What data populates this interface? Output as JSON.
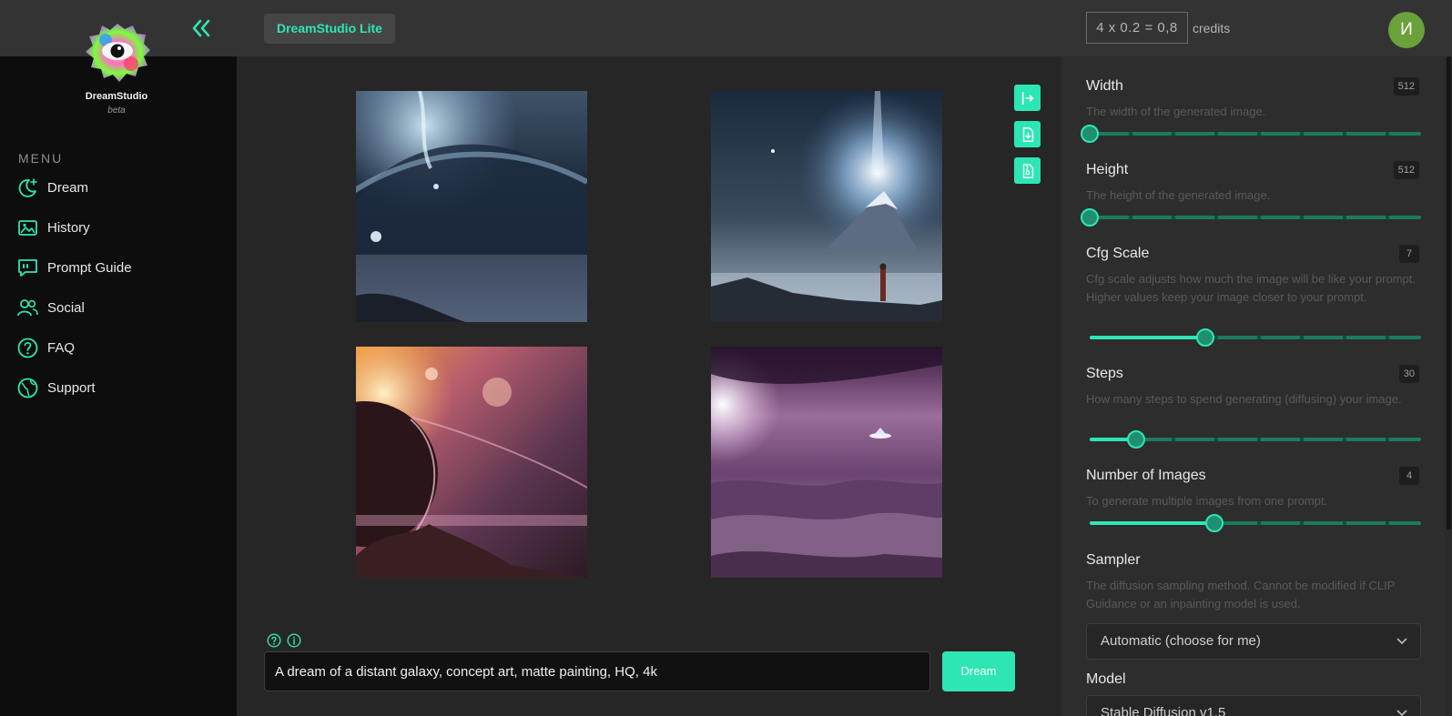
{
  "app": {
    "brand_name": "DreamStudio",
    "brand_tag": "beta",
    "tab_label": "DreamStudio Lite",
    "credits_formula": "4 x 0.2 = 0,8",
    "credits_label": "credits",
    "avatar_initial": "И",
    "accent_color": "#2ee6b4"
  },
  "sidebar": {
    "menu_title": "MENU",
    "items": [
      {
        "label": "Dream",
        "icon": "moon-sparkle-icon"
      },
      {
        "label": "History",
        "icon": "image-gallery-icon"
      },
      {
        "label": "Prompt Guide",
        "icon": "quote-bubble-icon"
      },
      {
        "label": "Social",
        "icon": "users-icon"
      },
      {
        "label": "FAQ",
        "icon": "question-circle-icon"
      },
      {
        "label": "Support",
        "icon": "globe-icon"
      }
    ]
  },
  "gallery": {
    "images": [
      "galaxy-storm-sea",
      "mountain-light-beam-figure",
      "planet-nebula-pink",
      "purple-hills-ufo"
    ],
    "actions": [
      "export-icon",
      "download-file-icon",
      "zip-file-icon"
    ]
  },
  "prompt": {
    "value": "A dream of a distant galaxy, concept art, matte painting, HQ, 4k",
    "dream_label": "Dream"
  },
  "settings": {
    "width": {
      "label": "Width",
      "desc": "The width of the generated image.",
      "value": "512",
      "level": 0
    },
    "height": {
      "label": "Height",
      "desc": "The height of the generated image.",
      "value": "512",
      "level": 0
    },
    "cfg": {
      "label": "Cfg Scale",
      "desc": "Cfg scale adjusts how much the image will be like your prompt. Higher values keep your image closer to your prompt.",
      "value": "7",
      "level": 0.35
    },
    "steps": {
      "label": "Steps",
      "desc": "How many steps to spend generating (diffusing) your image.",
      "value": "30",
      "level": 0.14
    },
    "num_images": {
      "label": "Number of Images",
      "desc": "To generate multiple images from one prompt.",
      "value": "4",
      "level": 0.375
    },
    "sampler": {
      "label": "Sampler",
      "desc": "The diffusion sampling method. Cannot be modified if CLIP Guidance or an inpainting model is used.",
      "value": "Automatic (choose for me)"
    },
    "model": {
      "label": "Model",
      "value": "Stable Diffusion v1.5"
    }
  }
}
